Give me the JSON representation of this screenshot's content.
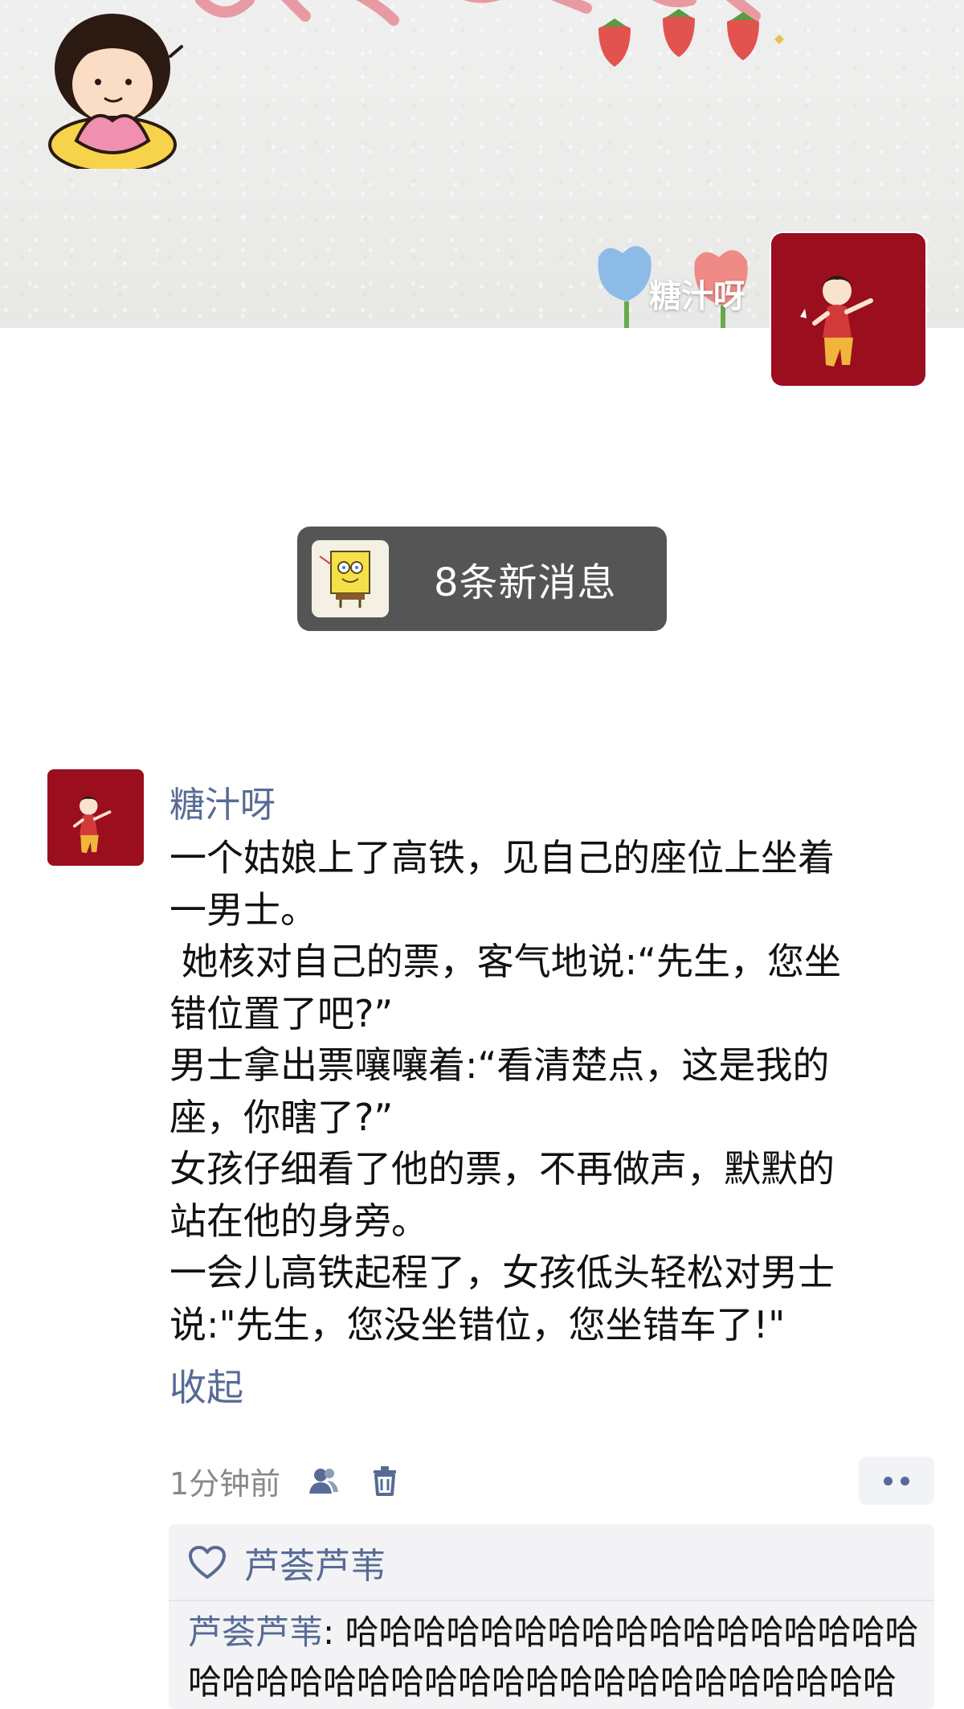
{
  "cover": {
    "username": "糖汁呀"
  },
  "new_messages": {
    "label": "8条新消息"
  },
  "post": {
    "author": "糖汁呀",
    "lines": [
      "一个姑娘上了高铁，见自己的座位上坐着",
      "一男士。",
      " 她核对自己的票，客气地说:“先生，您坐",
      "错位置了吧?”",
      "男士拿出票嚷嚷着:“看清楚点，这是我的",
      "座，你瞎了?”",
      "女孩仔细看了他的票，不再做声，默默的",
      "站在他的身旁。",
      "一会儿高铁起程了，女孩低头轻松对男士",
      "说:\"先生，您没坐错位，您坐错车了!\""
    ],
    "collapse_label": "收起",
    "time": "1分钟前",
    "icons": {
      "visibility": "contacts-icon",
      "delete": "trash-icon",
      "more": "more-dots-icon"
    }
  },
  "interactions": {
    "like_icon": "heart-outline-icon",
    "likes": "芦荟芦苇",
    "comment": {
      "author": "芦荟芦苇",
      "separator": ": ",
      "text_line1": "哈哈哈哈哈哈哈哈哈哈哈哈哈哈哈哈哈",
      "text_line2": "哈哈哈哈哈哈哈哈哈哈哈哈哈哈哈哈哈哈哈哈哈"
    }
  },
  "colors": {
    "link_blue": "#576b95",
    "avatar_red": "#9a0e1e",
    "pill_gray": "#555555",
    "comment_bg": "#f3f3f5"
  }
}
